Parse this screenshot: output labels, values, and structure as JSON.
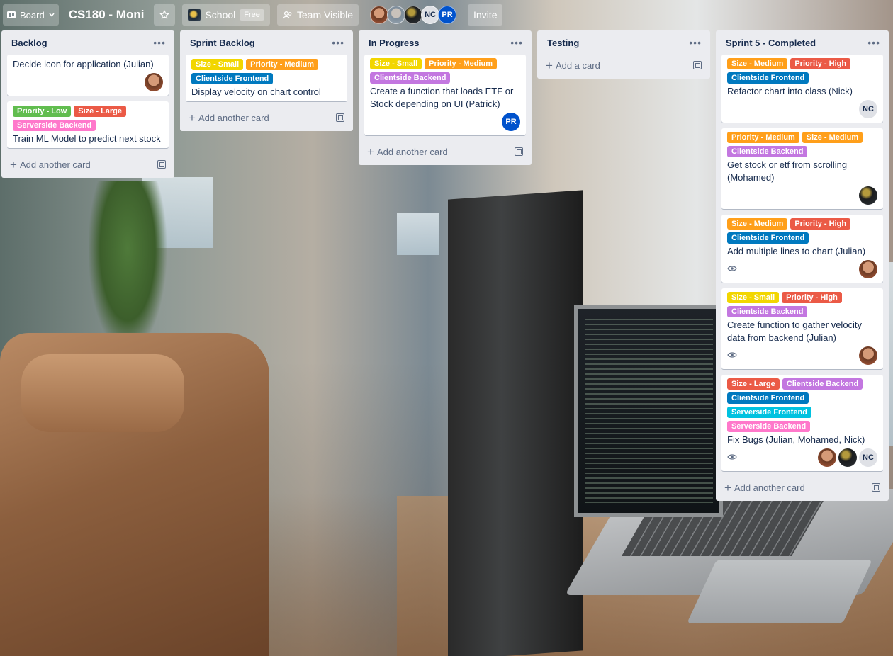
{
  "header": {
    "board_label": "Board",
    "board_title": "CS180 - Moni",
    "workspace": "School",
    "workspace_badge": "Free",
    "visibility": "Team Visible",
    "members": [
      {
        "initials": "",
        "kind": "julian"
      },
      {
        "initials": "",
        "kind": "other"
      },
      {
        "initials": "",
        "kind": "mohamed"
      },
      {
        "initials": "NC",
        "kind": "nick"
      },
      {
        "initials": "PR",
        "kind": "patrick"
      }
    ],
    "invite": "Invite"
  },
  "colors": {
    "yellow": "#f2d600",
    "orange": "#ff9f1a",
    "red": "#eb5a46",
    "green": "#61bd4f",
    "purple": "#c377e0",
    "blue": "#0079bf",
    "sky": "#00c2e0",
    "pink": "#ff78cb"
  },
  "lists": [
    {
      "title": "Backlog",
      "cards": [
        {
          "title": "Decide icon for application (Julian)",
          "labels": [],
          "avatars": [
            "julian"
          ],
          "watch": false
        },
        {
          "title": "Train ML Model to predict next stock",
          "labels": [
            {
              "text": "Priority - Low",
              "color": "green"
            },
            {
              "text": "Size - Large",
              "color": "red"
            },
            {
              "text": "Serverside Backend",
              "color": "pink"
            }
          ],
          "avatars": [],
          "watch": false
        }
      ],
      "add_label": "Add another card"
    },
    {
      "title": "Sprint Backlog",
      "cards": [
        {
          "title": "Display velocity on chart control",
          "labels": [
            {
              "text": "Size - Small",
              "color": "yellow"
            },
            {
              "text": "Priority - Medium",
              "color": "orange"
            },
            {
              "text": "Clientside Frontend",
              "color": "blue"
            }
          ],
          "avatars": [],
          "watch": false
        }
      ],
      "add_label": "Add another card"
    },
    {
      "title": "In Progress",
      "cards": [
        {
          "title": "Create a function that loads ETF or Stock depending on UI (Patrick)",
          "labels": [
            {
              "text": "Size - Small",
              "color": "yellow"
            },
            {
              "text": "Priority - Medium",
              "color": "orange"
            },
            {
              "text": "Clientside Backend",
              "color": "purple"
            }
          ],
          "avatars": [
            "patrick"
          ],
          "watch": false
        }
      ],
      "add_label": "Add another card"
    },
    {
      "title": "Testing",
      "cards": [],
      "add_label": "Add a card"
    },
    {
      "title": "Sprint 5 - Completed",
      "cards": [
        {
          "title": "Refactor chart into class (Nick)",
          "labels": [
            {
              "text": "Size - Medium",
              "color": "orange"
            },
            {
              "text": "Priority - High",
              "color": "red"
            },
            {
              "text": "Clientside Frontend",
              "color": "blue"
            }
          ],
          "avatars": [
            "nick"
          ],
          "watch": false
        },
        {
          "title": "Get stock or etf from scrolling (Mohamed)",
          "labels": [
            {
              "text": "Priority - Medium",
              "color": "orange"
            },
            {
              "text": "Size - Medium",
              "color": "orange"
            },
            {
              "text": "Clientside Backend",
              "color": "purple"
            }
          ],
          "avatars": [
            "mohamed"
          ],
          "watch": false
        },
        {
          "title": "Add multiple lines to chart (Julian)",
          "labels": [
            {
              "text": "Size - Medium",
              "color": "orange"
            },
            {
              "text": "Priority - High",
              "color": "red"
            },
            {
              "text": "Clientside Frontend",
              "color": "blue"
            }
          ],
          "avatars": [
            "julian"
          ],
          "watch": true
        },
        {
          "title": "Create function to gather velocity data from backend (Julian)",
          "labels": [
            {
              "text": "Size - Small",
              "color": "yellow"
            },
            {
              "text": "Priority - High",
              "color": "red"
            },
            {
              "text": "Clientside Backend",
              "color": "purple"
            }
          ],
          "avatars": [
            "julian"
          ],
          "watch": true
        },
        {
          "title": "Fix Bugs (Julian, Mohamed, Nick)",
          "labels": [
            {
              "text": "Size - Large",
              "color": "red"
            },
            {
              "text": "Clientside Backend",
              "color": "purple"
            },
            {
              "text": "Clientside Frontend",
              "color": "blue"
            },
            {
              "text": "Serverside Frontend",
              "color": "sky"
            },
            {
              "text": "Serverside Backend",
              "color": "pink"
            }
          ],
          "avatars": [
            "julian",
            "mohamed",
            "nick"
          ],
          "watch": true
        }
      ],
      "add_label": "Add another card"
    }
  ],
  "avatar_initials": {
    "nick": "NC",
    "patrick": "PR",
    "julian": "",
    "mohamed": ""
  },
  "icons": {
    "board": "board-icon",
    "star": "star-icon",
    "team": "team-visible-icon",
    "watch": "eye-icon",
    "template": "card-template-icon",
    "more": "ellipsis-icon"
  }
}
